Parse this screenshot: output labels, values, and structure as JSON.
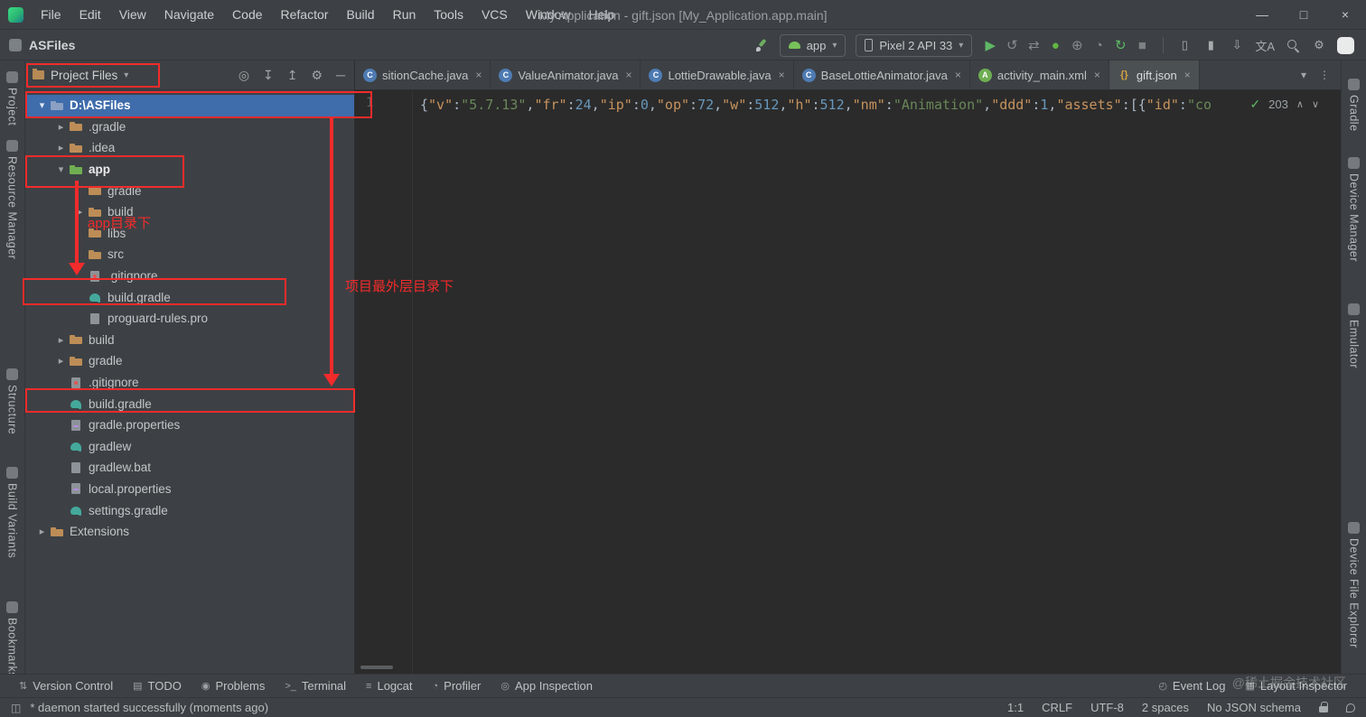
{
  "glyphs": {
    "chevron_down": "▾",
    "chevron_right": "▸",
    "close": "×",
    "check": "✓",
    "prev": "∧",
    "next": "∨",
    "layout_toggle": "◫"
  },
  "title_bar": {
    "menus": [
      "File",
      "Edit",
      "View",
      "Navigate",
      "Code",
      "Refactor",
      "Build",
      "Run",
      "Tools",
      "VCS",
      "Window",
      "Help"
    ],
    "title": "My Application - gift.json [My_Application.app.main]",
    "window_controls": {
      "minimize": "—",
      "maximize": "□",
      "close": "×"
    }
  },
  "toolbar": {
    "project_name": "ASFiles",
    "run_config": {
      "label": "app"
    },
    "device": {
      "label": "Pixel 2 API 33"
    },
    "run_icons": [
      {
        "name": "run-button",
        "glyph": "▶",
        "color": "#5fb865"
      },
      {
        "name": "apply-changes-button",
        "glyph": "↺",
        "color": "#868b8e"
      },
      {
        "name": "apply-code-changes-button",
        "glyph": "⇄",
        "color": "#868b8e"
      },
      {
        "name": "debug-button",
        "glyph": "●",
        "color": "#62b543"
      },
      {
        "name": "attach-debugger-button",
        "glyph": "⊕",
        "color": "#868b8e"
      },
      {
        "name": "profile-button",
        "glyph": "◔",
        "color": "#868b8e"
      },
      {
        "name": "sync-gradle-button",
        "glyph": "↻",
        "color": "#5fb865"
      },
      {
        "name": "stop-button",
        "glyph": "■",
        "color": "#7c8184"
      }
    ],
    "utility_icons": [
      {
        "name": "device-manager-button",
        "glyph": "▯",
        "color": "#a6abae"
      },
      {
        "name": "avd-manager-button",
        "glyph": "▮",
        "color": "#a6abae"
      },
      {
        "name": "sdk-manager-button",
        "glyph": "⇩",
        "color": "#a6abae"
      },
      {
        "name": "translate-button",
        "glyph": "文A",
        "color": "#a6abae"
      },
      {
        "name": "search-everywhere-button",
        "glyph": "",
        "color": "",
        "css": "search"
      },
      {
        "name": "settings-button",
        "glyph": "⚙",
        "color": "#a6abae"
      },
      {
        "name": "profile-avatar",
        "glyph": "",
        "color": "",
        "css": "avatar"
      }
    ]
  },
  "tool_strips": {
    "left": [
      "Project",
      "Resource Manager",
      "Structure",
      "Build Variants",
      "Bookmarks"
    ],
    "right": [
      "Gradle",
      "Device Manager",
      "Emulator",
      "Device File Explorer"
    ]
  },
  "project_panel": {
    "view_selector": "Project Files",
    "header_icons": [
      {
        "name": "locate-file-button",
        "glyph": "◎"
      },
      {
        "name": "expand-all-button",
        "glyph": "↧"
      },
      {
        "name": "collapse-all-button",
        "glyph": "↥"
      },
      {
        "name": "panel-settings-button",
        "glyph": "⚙"
      },
      {
        "name": "hide-panel-button",
        "glyph": "─"
      }
    ],
    "tree": [
      {
        "label": "D:\\ASFiles",
        "depth": 0,
        "chevron": "down",
        "icon": "project-folder",
        "selected": true
      },
      {
        "label": ".gradle",
        "depth": 1,
        "chevron": "right",
        "icon": "folder"
      },
      {
        "label": ".idea",
        "depth": 1,
        "chevron": "right",
        "icon": "folder"
      },
      {
        "label": "app",
        "depth": 1,
        "chevron": "down",
        "icon": "module-folder",
        "bold": true
      },
      {
        "label": "gradle",
        "depth": 2,
        "chevron": null,
        "icon": "folder"
      },
      {
        "label": "build",
        "depth": 2,
        "chevron": "right",
        "icon": "folder"
      },
      {
        "label": "libs",
        "depth": 2,
        "chevron": null,
        "icon": "folder"
      },
      {
        "label": "src",
        "depth": 2,
        "chevron": null,
        "icon": "folder"
      },
      {
        "label": ".gitignore",
        "depth": 2,
        "chevron": null,
        "icon": "git-file"
      },
      {
        "label": "build.gradle",
        "depth": 2,
        "chevron": null,
        "icon": "gradle-file"
      },
      {
        "label": "proguard-rules.pro",
        "depth": 2,
        "chevron": null,
        "icon": "text-file"
      },
      {
        "label": "build",
        "depth": 1,
        "chevron": "right",
        "icon": "folder"
      },
      {
        "label": "gradle",
        "depth": 1,
        "chevron": "right",
        "icon": "folder"
      },
      {
        "label": ".gitignore",
        "depth": 1,
        "chevron": null,
        "icon": "git-file"
      },
      {
        "label": "build.gradle",
        "depth": 1,
        "chevron": null,
        "icon": "gradle-file"
      },
      {
        "label": "gradle.properties",
        "depth": 1,
        "chevron": null,
        "icon": "properties-file"
      },
      {
        "label": "gradlew",
        "depth": 1,
        "chevron": null,
        "icon": "gradle-file"
      },
      {
        "label": "gradlew.bat",
        "depth": 1,
        "chevron": null,
        "icon": "text-file"
      },
      {
        "label": "local.properties",
        "depth": 1,
        "chevron": null,
        "icon": "properties-file"
      },
      {
        "label": "settings.gradle",
        "depth": 1,
        "chevron": null,
        "icon": "gradle-file"
      },
      {
        "label": "Extensions",
        "depth": 0,
        "chevron": "right",
        "icon": "folder"
      }
    ]
  },
  "editor": {
    "tabs": [
      {
        "label": "sitionCache.java",
        "icon": "java-class",
        "active": false
      },
      {
        "label": "ValueAnimator.java",
        "icon": "java-class",
        "active": false
      },
      {
        "label": "LottieDrawable.java",
        "icon": "java-class",
        "active": false
      },
      {
        "label": "BaseLottieAnimator.java",
        "icon": "java-class",
        "active": false
      },
      {
        "label": "activity_main.xml",
        "icon": "android-xml",
        "active": false
      },
      {
        "label": "gift.json",
        "icon": "json-file",
        "active": true
      }
    ],
    "tab_bar_controls": [
      {
        "name": "hidden-tabs-button",
        "glyph": "▾"
      },
      {
        "name": "tab-options-button",
        "glyph": "⋮"
      }
    ],
    "line_number": "1",
    "code_tokens": [
      {
        "t": "{",
        "c": "p"
      },
      {
        "t": "\"v\"",
        "c": "k"
      },
      {
        "t": ":",
        "c": "p"
      },
      {
        "t": "\"5.7.13\"",
        "c": "s"
      },
      {
        "t": ",",
        "c": "p"
      },
      {
        "t": "\"fr\"",
        "c": "k"
      },
      {
        "t": ":",
        "c": "p"
      },
      {
        "t": "24",
        "c": "n"
      },
      {
        "t": ",",
        "c": "p"
      },
      {
        "t": "\"ip\"",
        "c": "k"
      },
      {
        "t": ":",
        "c": "p"
      },
      {
        "t": "0",
        "c": "n"
      },
      {
        "t": ",",
        "c": "p"
      },
      {
        "t": "\"op\"",
        "c": "k"
      },
      {
        "t": ":",
        "c": "p"
      },
      {
        "t": "72",
        "c": "n"
      },
      {
        "t": ",",
        "c": "p"
      },
      {
        "t": "\"w\"",
        "c": "k"
      },
      {
        "t": ":",
        "c": "p"
      },
      {
        "t": "512",
        "c": "n"
      },
      {
        "t": ",",
        "c": "p"
      },
      {
        "t": "\"h\"",
        "c": "k"
      },
      {
        "t": ":",
        "c": "p"
      },
      {
        "t": "512",
        "c": "n"
      },
      {
        "t": ",",
        "c": "p"
      },
      {
        "t": "\"nm\"",
        "c": "k"
      },
      {
        "t": ":",
        "c": "p"
      },
      {
        "t": "\"Animation\"",
        "c": "s"
      },
      {
        "t": ",",
        "c": "p"
      },
      {
        "t": "\"ddd\"",
        "c": "k"
      },
      {
        "t": ":",
        "c": "p"
      },
      {
        "t": "1",
        "c": "n"
      },
      {
        "t": ",",
        "c": "p"
      },
      {
        "t": "\"assets\"",
        "c": "k"
      },
      {
        "t": ":",
        "c": "p"
      },
      {
        "t": "[{",
        "c": "p"
      },
      {
        "t": "\"id\"",
        "c": "k"
      },
      {
        "t": ":",
        "c": "p"
      },
      {
        "t": "\"co",
        "c": "s"
      }
    ],
    "inspections": {
      "count": "203"
    }
  },
  "annotations": {
    "app_label": "app目录下",
    "root_label": "项目最外层目录下"
  },
  "bottom_bar": {
    "left": [
      {
        "label": "Version Control",
        "glyph": "⇅"
      },
      {
        "label": "TODO",
        "glyph": "▤"
      },
      {
        "label": "Problems",
        "glyph": "◉"
      },
      {
        "label": "Terminal",
        "glyph": ">_"
      },
      {
        "label": "Logcat",
        "glyph": "≡"
      },
      {
        "label": "Profiler",
        "glyph": "◔"
      },
      {
        "label": "App Inspection",
        "glyph": "◎"
      }
    ],
    "right": [
      {
        "label": "Event Log",
        "glyph": "◴"
      },
      {
        "label": "Layout Inspector",
        "glyph": "▦"
      }
    ]
  },
  "status_bar": {
    "message": "* daemon started successfully (moments ago)",
    "items": [
      "1:1",
      "CRLF",
      "UTF-8",
      "2 spaces",
      "No JSON schema"
    ]
  },
  "watermark": "@稀土掘金技术社区"
}
